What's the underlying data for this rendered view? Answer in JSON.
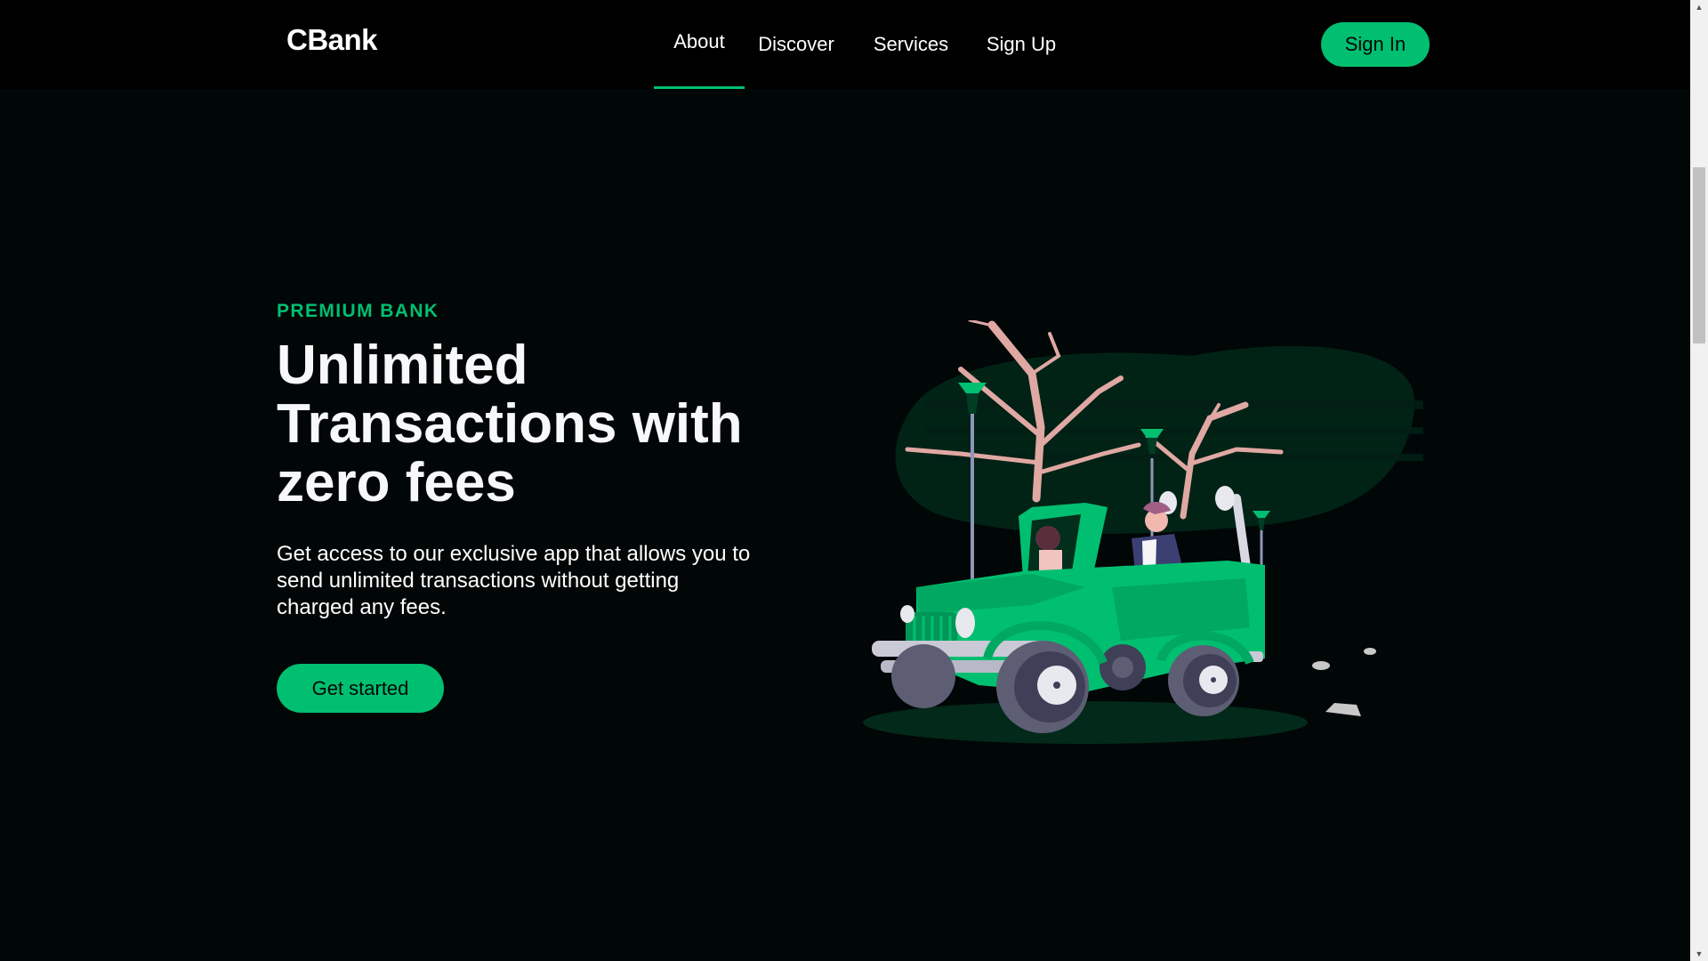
{
  "nav": {
    "logo": "CBank",
    "items": [
      {
        "label": "About",
        "active": true
      },
      {
        "label": "Discover",
        "active": false
      },
      {
        "label": "Services",
        "active": false
      },
      {
        "label": "Sign Up",
        "active": false
      }
    ],
    "signin_label": "Sign In"
  },
  "hero": {
    "topline": "PREMIUM BANK",
    "heading": "Unlimited Transactions with zero fees",
    "subtitle": "Get access to our exclusive app that allows you to send unlimited transactions without getting charged any fees.",
    "cta_label": "Get started",
    "illustration_icon": "car-drive-illustration"
  },
  "colors": {
    "accent": "#01bf71",
    "background": "#010606",
    "nav_background": "#000000"
  },
  "scrollbar": {
    "up_icon": "scroll-up-arrow",
    "down_icon": "scroll-down-arrow"
  }
}
